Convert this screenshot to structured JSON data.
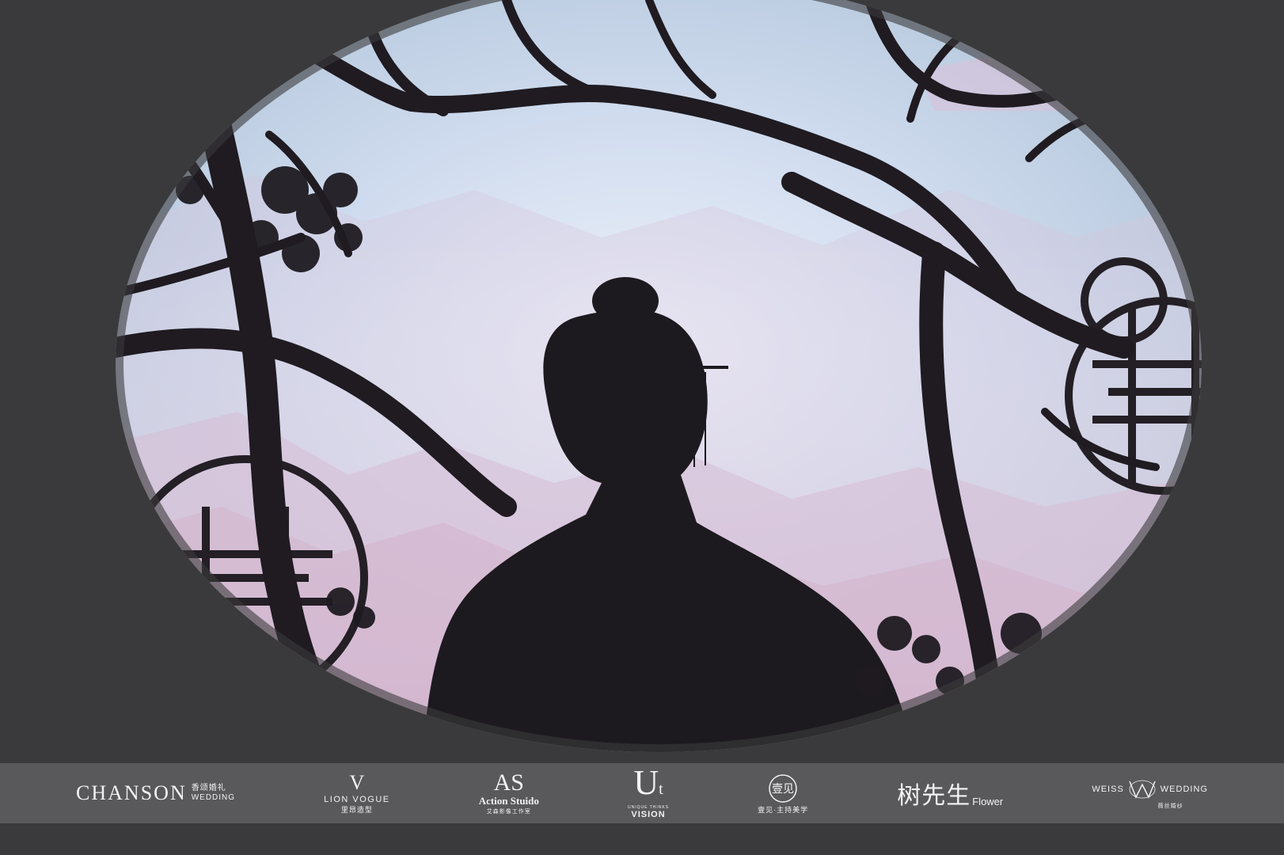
{
  "logos": {
    "chanson": {
      "main": "CHANSON",
      "cn": "香颂婚礼",
      "sub": "WEDDING"
    },
    "lion_vogue": {
      "mark": "V",
      "name": "LION VOGUE",
      "cn": "里昂造型"
    },
    "action_studio": {
      "mark": "AS",
      "name": "Action Stuido",
      "cn": "艾森影像工作室"
    },
    "unique_vision": {
      "mark_u": "U",
      "mark_t": "t",
      "sub": "UNIQUE THINKS",
      "name": "VISION"
    },
    "yijian": {
      "seal": "壹见",
      "cn": "壹见·主持美学"
    },
    "shu_xiansheng": {
      "cn": "树先生",
      "en": "Flower"
    },
    "weiss": {
      "left": "WEISS",
      "right": "WEDDING",
      "cn": "薇丝婚纱"
    }
  },
  "colors": {
    "frame": "#3a3a3c",
    "sky_top": "#c8dce8",
    "sky_mid": "#d4dff0",
    "mountain_pink": "#d7b4cf",
    "silhouette": "#1d1a1f",
    "logo_bar": "#5c5c5e",
    "logo_text": "#f2f2f2"
  }
}
